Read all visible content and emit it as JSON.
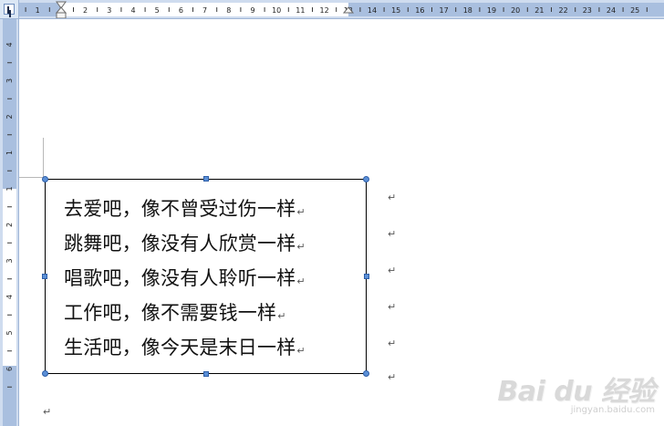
{
  "ruler": {
    "horizontal_numbers": [
      "2",
      "1",
      "1",
      "2",
      "3",
      "4",
      "5",
      "6",
      "7",
      "8",
      "9",
      "10",
      "11",
      "12",
      "13",
      "14",
      "15",
      "16",
      "17",
      "18",
      "19",
      "20",
      "21",
      "22",
      "23",
      "24",
      "25"
    ],
    "vertical_numbers": [
      "4",
      "3",
      "2",
      "1",
      "1",
      "2",
      "3",
      "4",
      "5",
      "6"
    ]
  },
  "document": {
    "lines": [
      "去爱吧，像不曾受过伤一样",
      "跳舞吧，像没有人欣赏一样",
      "唱歌吧，像没有人聆听一样",
      "工作吧，像不需要钱一样",
      "生活吧，像今天是末日一样"
    ],
    "paragraph_mark": "↵"
  },
  "watermark": {
    "logo": "Bai du 经验",
    "url": "jingyan.baidu.com"
  }
}
